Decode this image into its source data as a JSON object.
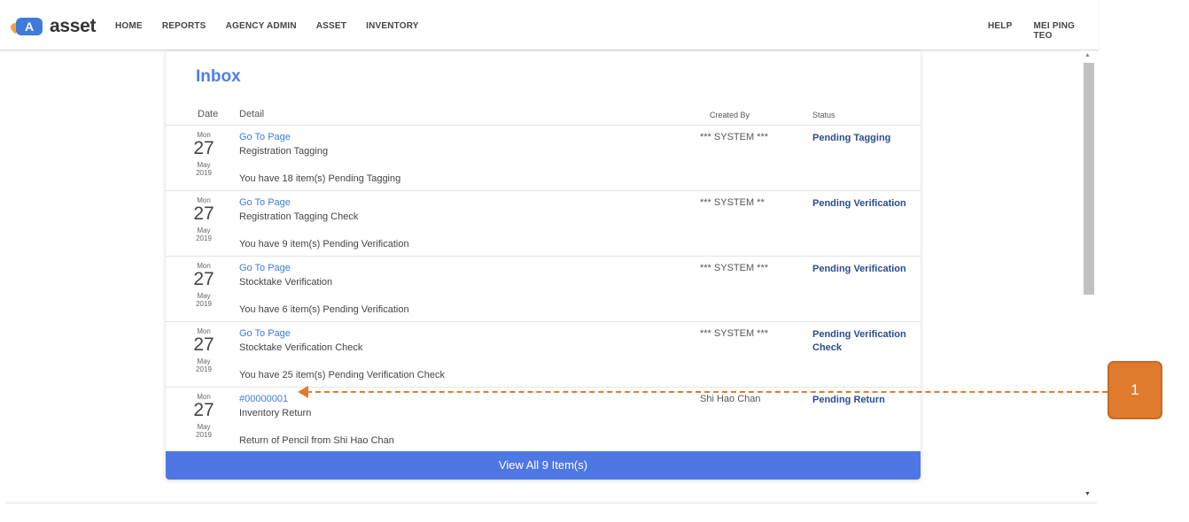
{
  "app": {
    "logo_letter": "A",
    "logo_text": "asset"
  },
  "nav": {
    "items": [
      "HOME",
      "REPORTS",
      "AGENCY ADMIN",
      "ASSET",
      "INVENTORY"
    ],
    "right": [
      "HELP",
      "MEI PING TEO"
    ]
  },
  "inbox": {
    "title": "Inbox",
    "headers": {
      "date": "Date",
      "detail": "Detail",
      "created_by": "Created By",
      "status": "Status"
    },
    "rows": [
      {
        "weekday": "Mon",
        "day": "27",
        "month_year": "May 2019",
        "link": "Go To Page",
        "title": "Registration Tagging",
        "message": "You have 18 item(s) Pending Tagging",
        "created_by": "*** SYSTEM ***",
        "status": "Pending Tagging"
      },
      {
        "weekday": "Mon",
        "day": "27",
        "month_year": "May 2019",
        "link": "Go To Page",
        "title": "Registration Tagging Check",
        "message": "You have 9 item(s) Pending Verification",
        "created_by": "*** SYSTEM **",
        "status": "Pending Verification"
      },
      {
        "weekday": "Mon",
        "day": "27",
        "month_year": "May 2019",
        "link": "Go To Page",
        "title": "Stocktake Verification",
        "message": "You have 6 item(s) Pending Verification",
        "created_by": "*** SYSTEM ***",
        "status": "Pending Verification"
      },
      {
        "weekday": "Mon",
        "day": "27",
        "month_year": "May 2019",
        "link": "Go To Page",
        "title": "Stocktake Verification Check",
        "message": "You have 25 item(s) Pending Verification Check",
        "created_by": "*** SYSTEM ***",
        "status": "Pending Verification Check"
      },
      {
        "weekday": "Mon",
        "day": "27",
        "month_year": "May 2019",
        "link": "#00000001",
        "title": "Inventory Return",
        "message": "Return of Pencil from Shi Hao Chan",
        "created_by": "Shi Hao Chan",
        "status": "Pending Return"
      }
    ],
    "view_all": "View All 9 Item(s)"
  },
  "callout": {
    "label": "1"
  },
  "colors": {
    "accent": "#4e77e4",
    "link": "#3b7ddd",
    "status": "#2a4d8f",
    "callout": "#e07b2e"
  }
}
